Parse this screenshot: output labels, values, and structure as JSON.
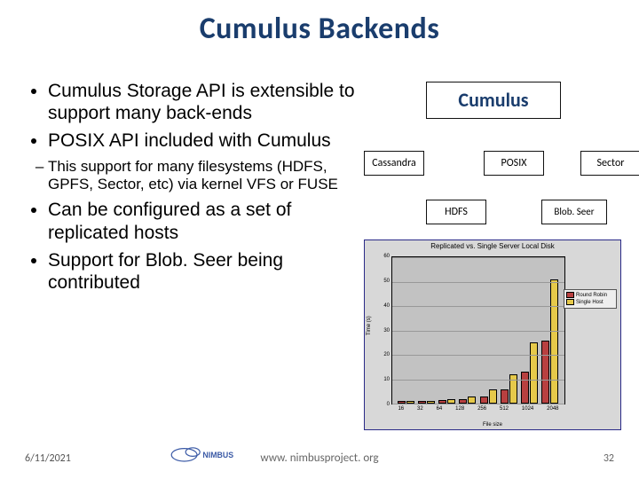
{
  "title": "Cumulus Backends",
  "bullets": {
    "b1": "Cumulus Storage API is extensible to support many back-ends",
    "b2": "POSIX API included with Cumulus",
    "b2_sub": "This support for many filesystems (HDFS, GPFS, Sector, etc) via kernel VFS or FUSE",
    "b3": "Can be configured as a set of replicated hosts",
    "b4": "Support for Blob. Seer being contributed"
  },
  "diagram": {
    "main": "Cumulus",
    "nodes": {
      "cassandra": "Cassandra",
      "posix": "POSIX",
      "sector": "Sector",
      "hdfs": "HDFS",
      "blobseer": "Blob. Seer"
    }
  },
  "chart_data": {
    "type": "bar",
    "title": "Replicated vs. Single Server Local Disk",
    "xlabel": "File size",
    "ylabel": "Time (s)",
    "ylim": [
      0,
      60
    ],
    "y_ticks": [
      0,
      10,
      20,
      30,
      40,
      50,
      60
    ],
    "categories": [
      "16",
      "32",
      "64",
      "128",
      "256",
      "512",
      "1024",
      "2048"
    ],
    "series": [
      {
        "name": "Round Robin",
        "color": "#b84040",
        "values": [
          1,
          1,
          1.5,
          2,
          3,
          6,
          13,
          26
        ]
      },
      {
        "name": "Single Host",
        "color": "#e6c94a",
        "values": [
          1,
          1,
          2,
          3,
          6,
          12,
          25,
          51
        ]
      }
    ]
  },
  "footer": {
    "date": "6/11/2021",
    "url": "www. nimbusproject. org",
    "page": "32",
    "logo_text": "NIMBUS"
  }
}
